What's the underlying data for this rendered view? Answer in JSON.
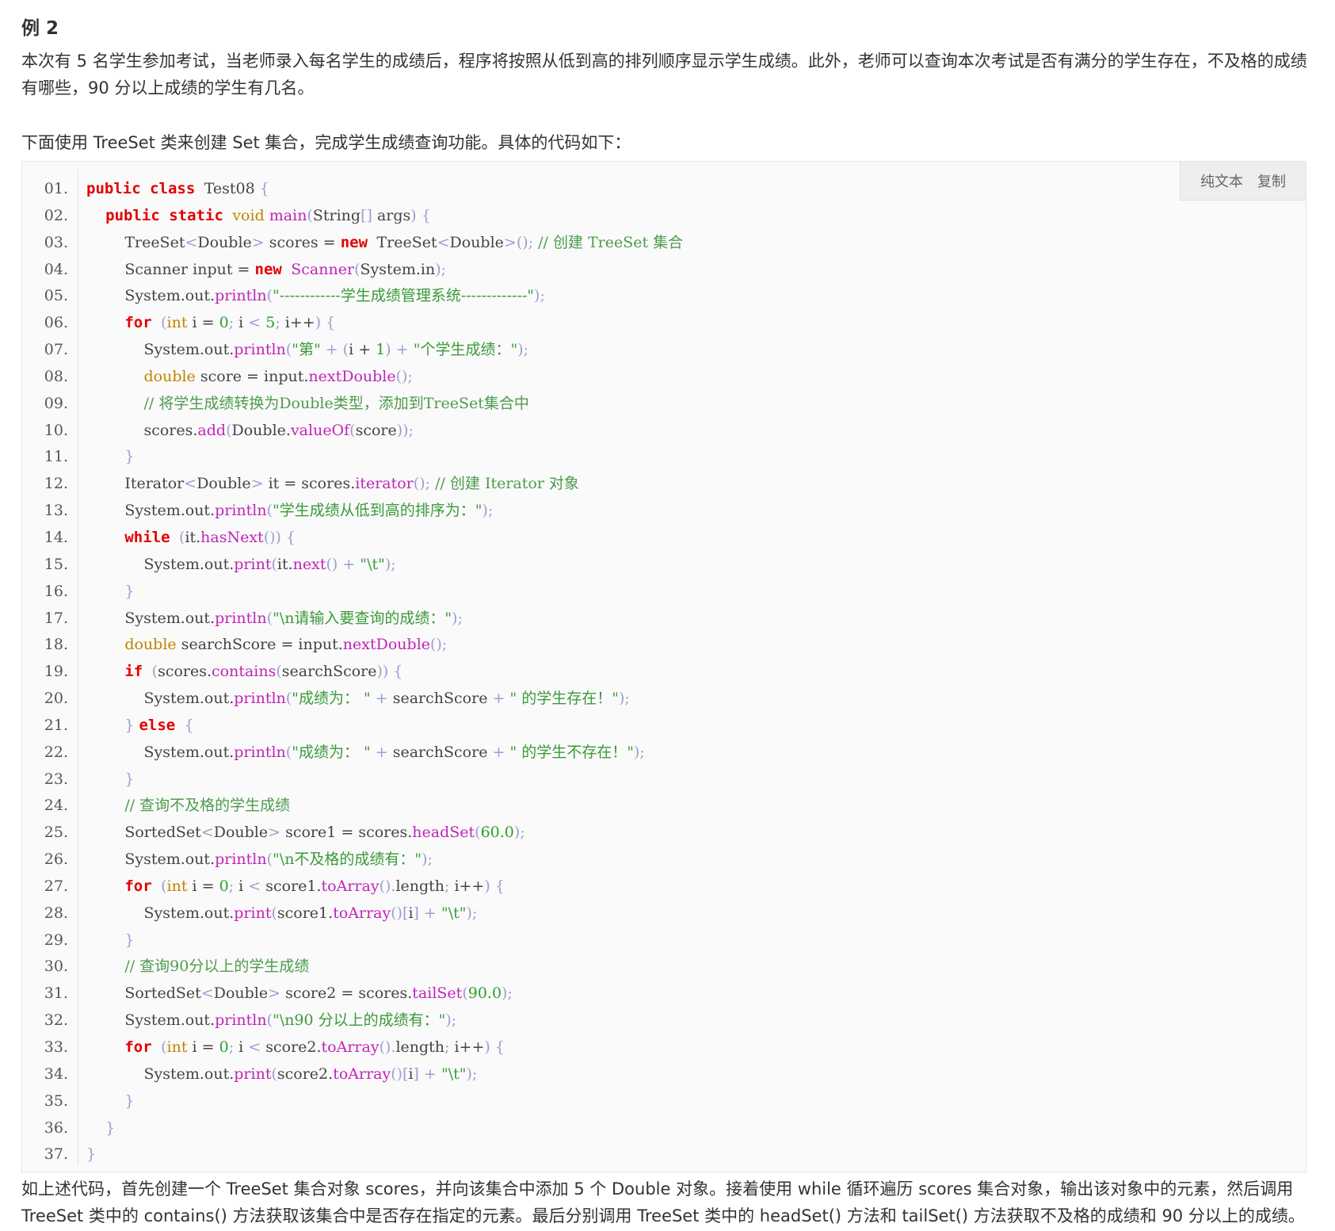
{
  "heading": "例 2",
  "intro_paragraph": "本次有 5 名学生参加考试，当老师录入每名学生的成绩后，程序将按照从低到高的排列顺序显示学生成绩。此外，老师可以查询本次考试是否有满分的学生存在，不及格的成绩有哪些，90 分以上成绩的学生有几名。",
  "lead_paragraph": "下面使用 TreeSet 类来创建 Set 集合，完成学生成绩查询功能。具体的代码如下：",
  "toolbar": {
    "plain_text": "纯文本",
    "copy": "复制"
  },
  "code_lines": [
    {
      "n": "01.",
      "tokens": [
        [
          "kw",
          "public class "
        ],
        [
          "",
          "Test08 "
        ],
        [
          "pn",
          "{"
        ]
      ]
    },
    {
      "n": "02.",
      "tokens": [
        [
          "",
          "    "
        ],
        [
          "kw",
          "public static "
        ],
        [
          "ty",
          "void "
        ],
        [
          "fn",
          "main"
        ],
        [
          "pn",
          "("
        ],
        [
          "",
          "String"
        ],
        [
          "pn",
          "[] "
        ],
        [
          "",
          "args"
        ],
        [
          "pn",
          ") {"
        ]
      ]
    },
    {
      "n": "03.",
      "tokens": [
        [
          "",
          "        TreeSet"
        ],
        [
          "pn",
          "<"
        ],
        [
          "",
          "Double"
        ],
        [
          "pn",
          "> "
        ],
        [
          "",
          "scores = "
        ],
        [
          "kw",
          "new "
        ],
        [
          "",
          "TreeSet"
        ],
        [
          "pn",
          "<"
        ],
        [
          "",
          "Double"
        ],
        [
          "pn",
          ">(); "
        ],
        [
          "cm",
          "// 创建 TreeSet 集合"
        ]
      ]
    },
    {
      "n": "04.",
      "tokens": [
        [
          "",
          "        Scanner input = "
        ],
        [
          "kw",
          "new "
        ],
        [
          "fn",
          "Scanner"
        ],
        [
          "pn",
          "("
        ],
        [
          "",
          "System.in"
        ],
        [
          "pn",
          ");"
        ]
      ]
    },
    {
      "n": "05.",
      "tokens": [
        [
          "",
          "        System.out."
        ],
        [
          "fn",
          "println"
        ],
        [
          "pn",
          "("
        ],
        [
          "st",
          "\"------------学生成绩管理系统-------------\""
        ],
        [
          "pn",
          ");"
        ]
      ]
    },
    {
      "n": "06.",
      "tokens": [
        [
          "",
          "        "
        ],
        [
          "kw",
          "for "
        ],
        [
          "pn",
          "("
        ],
        [
          "ty",
          "int "
        ],
        [
          "",
          "i = "
        ],
        [
          "nm",
          "0"
        ],
        [
          "pn",
          "; "
        ],
        [
          "",
          "i "
        ],
        [
          "pn",
          "< "
        ],
        [
          "nm",
          "5"
        ],
        [
          "pn",
          "; "
        ],
        [
          "",
          "i++"
        ],
        [
          "pn",
          ") {"
        ]
      ]
    },
    {
      "n": "07.",
      "tokens": [
        [
          "",
          "            System.out."
        ],
        [
          "fn",
          "println"
        ],
        [
          "pn",
          "("
        ],
        [
          "st",
          "\"第\""
        ],
        [
          "pn",
          " + ("
        ],
        [
          "",
          "i + "
        ],
        [
          "nm",
          "1"
        ],
        [
          "pn",
          ") + "
        ],
        [
          "st",
          "\"个学生成绩：\""
        ],
        [
          "pn",
          ");"
        ]
      ]
    },
    {
      "n": "08.",
      "tokens": [
        [
          "",
          "            "
        ],
        [
          "ty",
          "double "
        ],
        [
          "",
          "score = input."
        ],
        [
          "fn",
          "nextDouble"
        ],
        [
          "pn",
          "();"
        ]
      ]
    },
    {
      "n": "09.",
      "tokens": [
        [
          "",
          "            "
        ],
        [
          "cm",
          "// 将学生成绩转换为Double类型，添加到TreeSet集合中"
        ]
      ]
    },
    {
      "n": "10.",
      "tokens": [
        [
          "",
          "            scores."
        ],
        [
          "fn",
          "add"
        ],
        [
          "pn",
          "("
        ],
        [
          "",
          "Double."
        ],
        [
          "fn",
          "valueOf"
        ],
        [
          "pn",
          "("
        ],
        [
          "",
          "score"
        ],
        [
          "pn",
          "));"
        ]
      ]
    },
    {
      "n": "11.",
      "tokens": [
        [
          "",
          "        "
        ],
        [
          "pn",
          "}"
        ]
      ]
    },
    {
      "n": "12.",
      "tokens": [
        [
          "",
          "        Iterator"
        ],
        [
          "pn",
          "<"
        ],
        [
          "",
          "Double"
        ],
        [
          "pn",
          "> "
        ],
        [
          "",
          "it = scores."
        ],
        [
          "fn",
          "iterator"
        ],
        [
          "pn",
          "(); "
        ],
        [
          "cm",
          "// 创建 Iterator 对象"
        ]
      ]
    },
    {
      "n": "13.",
      "tokens": [
        [
          "",
          "        System.out."
        ],
        [
          "fn",
          "println"
        ],
        [
          "pn",
          "("
        ],
        [
          "st",
          "\"学生成绩从低到高的排序为：\""
        ],
        [
          "pn",
          ");"
        ]
      ]
    },
    {
      "n": "14.",
      "tokens": [
        [
          "",
          "        "
        ],
        [
          "kw",
          "while "
        ],
        [
          "pn",
          "("
        ],
        [
          "",
          "it."
        ],
        [
          "fn",
          "hasNext"
        ],
        [
          "pn",
          "()) {"
        ]
      ]
    },
    {
      "n": "15.",
      "tokens": [
        [
          "",
          "            System.out."
        ],
        [
          "fn",
          "print"
        ],
        [
          "pn",
          "("
        ],
        [
          "",
          "it."
        ],
        [
          "fn",
          "next"
        ],
        [
          "pn",
          "() + "
        ],
        [
          "st",
          "\"\\t\""
        ],
        [
          "pn",
          ");"
        ]
      ]
    },
    {
      "n": "16.",
      "tokens": [
        [
          "",
          "        "
        ],
        [
          "pn",
          "}"
        ]
      ]
    },
    {
      "n": "17.",
      "tokens": [
        [
          "",
          "        System.out."
        ],
        [
          "fn",
          "println"
        ],
        [
          "pn",
          "("
        ],
        [
          "st",
          "\"\\n请输入要查询的成绩：\""
        ],
        [
          "pn",
          ");"
        ]
      ]
    },
    {
      "n": "18.",
      "tokens": [
        [
          "",
          "        "
        ],
        [
          "ty",
          "double "
        ],
        [
          "",
          "searchScore = input."
        ],
        [
          "fn",
          "nextDouble"
        ],
        [
          "pn",
          "();"
        ]
      ]
    },
    {
      "n": "19.",
      "tokens": [
        [
          "",
          "        "
        ],
        [
          "kw",
          "if "
        ],
        [
          "pn",
          "("
        ],
        [
          "",
          "scores."
        ],
        [
          "fn",
          "contains"
        ],
        [
          "pn",
          "("
        ],
        [
          "",
          "searchScore"
        ],
        [
          "pn",
          ")) {"
        ]
      ]
    },
    {
      "n": "20.",
      "tokens": [
        [
          "",
          "            System.out."
        ],
        [
          "fn",
          "println"
        ],
        [
          "pn",
          "("
        ],
        [
          "st",
          "\"成绩为： \""
        ],
        [
          "pn",
          " + "
        ],
        [
          "",
          "searchScore"
        ],
        [
          "pn",
          " + "
        ],
        [
          "st",
          "\" 的学生存在！\""
        ],
        [
          "pn",
          ");"
        ]
      ]
    },
    {
      "n": "21.",
      "tokens": [
        [
          "",
          "        "
        ],
        [
          "pn",
          "} "
        ],
        [
          "kw",
          "else "
        ],
        [
          "pn",
          "{"
        ]
      ]
    },
    {
      "n": "22.",
      "tokens": [
        [
          "",
          "            System.out."
        ],
        [
          "fn",
          "println"
        ],
        [
          "pn",
          "("
        ],
        [
          "st",
          "\"成绩为： \""
        ],
        [
          "pn",
          " + "
        ],
        [
          "",
          "searchScore"
        ],
        [
          "pn",
          " + "
        ],
        [
          "st",
          "\" 的学生不存在！\""
        ],
        [
          "pn",
          ");"
        ]
      ]
    },
    {
      "n": "23.",
      "tokens": [
        [
          "",
          "        "
        ],
        [
          "pn",
          "}"
        ]
      ]
    },
    {
      "n": "24.",
      "tokens": [
        [
          "",
          "        "
        ],
        [
          "cm",
          "// 查询不及格的学生成绩"
        ]
      ]
    },
    {
      "n": "25.",
      "tokens": [
        [
          "",
          "        SortedSet"
        ],
        [
          "pn",
          "<"
        ],
        [
          "",
          "Double"
        ],
        [
          "pn",
          "> "
        ],
        [
          "",
          "score1 = scores."
        ],
        [
          "fn",
          "headSet"
        ],
        [
          "pn",
          "("
        ],
        [
          "nm",
          "60.0"
        ],
        [
          "pn",
          ");"
        ]
      ]
    },
    {
      "n": "26.",
      "tokens": [
        [
          "",
          "        System.out."
        ],
        [
          "fn",
          "println"
        ],
        [
          "pn",
          "("
        ],
        [
          "st",
          "\"\\n不及格的成绩有：\""
        ],
        [
          "pn",
          ");"
        ]
      ]
    },
    {
      "n": "27.",
      "tokens": [
        [
          "",
          "        "
        ],
        [
          "kw",
          "for "
        ],
        [
          "pn",
          "("
        ],
        [
          "ty",
          "int "
        ],
        [
          "",
          "i = "
        ],
        [
          "nm",
          "0"
        ],
        [
          "pn",
          "; "
        ],
        [
          "",
          "i "
        ],
        [
          "pn",
          "< "
        ],
        [
          "",
          "score1."
        ],
        [
          "fn",
          "toArray"
        ],
        [
          "pn",
          "()."
        ],
        [
          "",
          "length"
        ],
        [
          "pn",
          "; "
        ],
        [
          "",
          "i++"
        ],
        [
          "pn",
          ") {"
        ]
      ]
    },
    {
      "n": "28.",
      "tokens": [
        [
          "",
          "            System.out."
        ],
        [
          "fn",
          "print"
        ],
        [
          "pn",
          "("
        ],
        [
          "",
          "score1."
        ],
        [
          "fn",
          "toArray"
        ],
        [
          "pn",
          "()["
        ],
        [
          "",
          "i"
        ],
        [
          "pn",
          "] + "
        ],
        [
          "st",
          "\"\\t\""
        ],
        [
          "pn",
          ");"
        ]
      ]
    },
    {
      "n": "29.",
      "tokens": [
        [
          "",
          "        "
        ],
        [
          "pn",
          "}"
        ]
      ]
    },
    {
      "n": "30.",
      "tokens": [
        [
          "",
          "        "
        ],
        [
          "cm",
          "// 查询90分以上的学生成绩"
        ]
      ]
    },
    {
      "n": "31.",
      "tokens": [
        [
          "",
          "        SortedSet"
        ],
        [
          "pn",
          "<"
        ],
        [
          "",
          "Double"
        ],
        [
          "pn",
          "> "
        ],
        [
          "",
          "score2 = scores."
        ],
        [
          "fn",
          "tailSet"
        ],
        [
          "pn",
          "("
        ],
        [
          "nm",
          "90.0"
        ],
        [
          "pn",
          ");"
        ]
      ]
    },
    {
      "n": "32.",
      "tokens": [
        [
          "",
          "        System.out."
        ],
        [
          "fn",
          "println"
        ],
        [
          "pn",
          "("
        ],
        [
          "st",
          "\"\\n90 分以上的成绩有：\""
        ],
        [
          "pn",
          ");"
        ]
      ]
    },
    {
      "n": "33.",
      "tokens": [
        [
          "",
          "        "
        ],
        [
          "kw",
          "for "
        ],
        [
          "pn",
          "("
        ],
        [
          "ty",
          "int "
        ],
        [
          "",
          "i = "
        ],
        [
          "nm",
          "0"
        ],
        [
          "pn",
          "; "
        ],
        [
          "",
          "i "
        ],
        [
          "pn",
          "< "
        ],
        [
          "",
          "score2."
        ],
        [
          "fn",
          "toArray"
        ],
        [
          "pn",
          "()."
        ],
        [
          "",
          "length"
        ],
        [
          "pn",
          "; "
        ],
        [
          "",
          "i++"
        ],
        [
          "pn",
          ") {"
        ]
      ]
    },
    {
      "n": "34.",
      "tokens": [
        [
          "",
          "            System.out."
        ],
        [
          "fn",
          "print"
        ],
        [
          "pn",
          "("
        ],
        [
          "",
          "score2."
        ],
        [
          "fn",
          "toArray"
        ],
        [
          "pn",
          "()["
        ],
        [
          "",
          "i"
        ],
        [
          "pn",
          "] + "
        ],
        [
          "st",
          "\"\\t\""
        ],
        [
          "pn",
          ");"
        ]
      ]
    },
    {
      "n": "35.",
      "tokens": [
        [
          "",
          "        "
        ],
        [
          "pn",
          "}"
        ]
      ]
    },
    {
      "n": "36.",
      "tokens": [
        [
          "",
          "    "
        ],
        [
          "pn",
          "}"
        ]
      ]
    },
    {
      "n": "37.",
      "tokens": [
        [
          "pn",
          "}"
        ]
      ]
    }
  ],
  "outro_paragraph": "如上述代码，首先创建一个 TreeSet 集合对象 scores，并向该集合中添加 5 个 Double 对象。接着使用 while 循环遍历 scores 集合对象，输出该对象中的元素，然后调用 TreeSet 类中的 contains() 方法获取该集合中是否存在指定的元素。最后分别调用 TreeSet 类中的 headSet() 方法和 tailSet() 方法获取不及格的成绩和 90 分以上的成绩。"
}
